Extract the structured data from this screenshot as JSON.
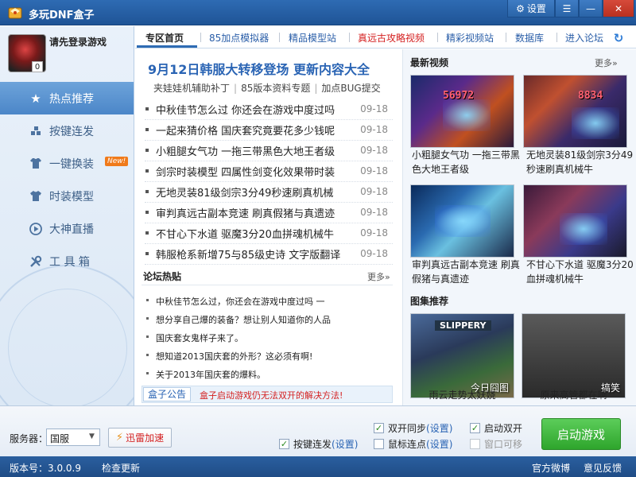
{
  "app": {
    "title": "多玩DNF盒子",
    "logo_icon": "box-logo-icon"
  },
  "titlebar": {
    "settings_label": "设置"
  },
  "user": {
    "login_prompt": "请先登录游戏",
    "badge_count": "0"
  },
  "sidebar": {
    "items": [
      {
        "label": "热点推荐",
        "icon": "star-icon",
        "active": true
      },
      {
        "label": "按键连发",
        "icon": "blocks-icon"
      },
      {
        "label": "一键换装",
        "icon": "outfit-icon",
        "badge": "New!"
      },
      {
        "label": "时装模型",
        "icon": "shirt-icon"
      },
      {
        "label": "大神直播",
        "icon": "play-icon"
      },
      {
        "label": "工 具 箱",
        "icon": "wrench-icon"
      }
    ]
  },
  "tabs": [
    {
      "label": "专区首页",
      "active": true
    },
    {
      "label": "85加点模拟器"
    },
    {
      "label": "精品模型站"
    },
    {
      "label": "真远古攻略视频",
      "highlight": true
    },
    {
      "label": "精彩视频站"
    },
    {
      "label": "数据库"
    },
    {
      "label": "进入论坛"
    }
  ],
  "headline": {
    "title": "9月12日韩服大转移登场  更新内容大全",
    "sublinks": [
      "夹娃娃机辅助补丁",
      "85版本资料专题",
      "加点BUG提交"
    ]
  },
  "news": [
    {
      "title": "中秋佳节怎么过  你还会在游戏中度过吗",
      "date": "09-18"
    },
    {
      "title": "一起来猜价格  国庆套究竟要花多少钱呢",
      "date": "09-18"
    },
    {
      "title": "小粗腿女气功  一拖三带黑色大地王者级",
      "date": "09-18"
    },
    {
      "title": "剑宗时装模型  四属性剑变化效果带时装",
      "date": "09-18"
    },
    {
      "title": "无地灵装81级剑宗3分49秒速刷真机械",
      "date": "09-18"
    },
    {
      "title": "审判真远古副本竞速  刷真假猪与真遗迹",
      "date": "09-18"
    },
    {
      "title": "不甘心下水道  驱魔3分20血拼魂机械牛",
      "date": "09-18"
    },
    {
      "title": "韩服枪系新增75与85级史诗  文字版翻译",
      "date": "09-18"
    }
  ],
  "forum": {
    "title": "论坛热贴",
    "more": "更多»",
    "items": [
      "中秋佳节怎么过，你还会在游戏中度过吗 一",
      "想分享自己爆的装备？想让别人知道你的人品",
      "国庆套女鬼样子来了。",
      "想知道2013国庆套的外形？这必须有啊!",
      "关于2013年国庆套的爆料。"
    ]
  },
  "notice": {
    "tag": "盒子公告",
    "text": "盒子启动游戏仍无法双开的解决方法!"
  },
  "videos": {
    "title": "最新视频",
    "more": "更多»",
    "items": [
      {
        "caption": "小粗腿女气功  一拖三带黑色大地王者级",
        "overlay": "56972"
      },
      {
        "caption": "无地灵装81级剑宗3分49秒速刷真机械牛",
        "overlay": "8834"
      },
      {
        "caption": "审判真远古副本竞速  刷真假猪与真遗迹",
        "overlay": ""
      },
      {
        "caption": "不甘心下水道  驱魔3分20血拼魂机械牛",
        "overlay": ""
      }
    ]
  },
  "gallery": {
    "title": "图集推荐",
    "items": [
      {
        "caption": "雨云走势太妖娆",
        "overlay": "SLIPPERY",
        "stamp": "今日囧图"
      },
      {
        "caption": "原来高管都在啊",
        "stamp": "搞笑"
      }
    ]
  },
  "bottom": {
    "server_label": "服务器：",
    "server_value": "国服",
    "xunlei_label": "迅雷加速",
    "checks": [
      {
        "label": "双开同步",
        "setting": "(设置)",
        "checked": true
      },
      {
        "label": "启动双开",
        "checked": true
      },
      {
        "label": "按键连发",
        "setting": "(设置)",
        "checked": true
      },
      {
        "label": "鼠标连点",
        "setting": "(设置)",
        "checked": false
      },
      {
        "label": "窗口可移",
        "checked": false,
        "disabled": true
      }
    ],
    "start_label": "启动游戏"
  },
  "status": {
    "version": "版本号：3.0.0.9",
    "check_update": "检查更新",
    "weibo": "官方微博",
    "feedback": "意见反馈"
  },
  "colors": {
    "titlebar": "#2e6bb3",
    "accent_blue": "#2a64b4",
    "highlight_red": "#d42020",
    "start_green": "#2ea52c",
    "nav_active": "#4b86c8"
  }
}
